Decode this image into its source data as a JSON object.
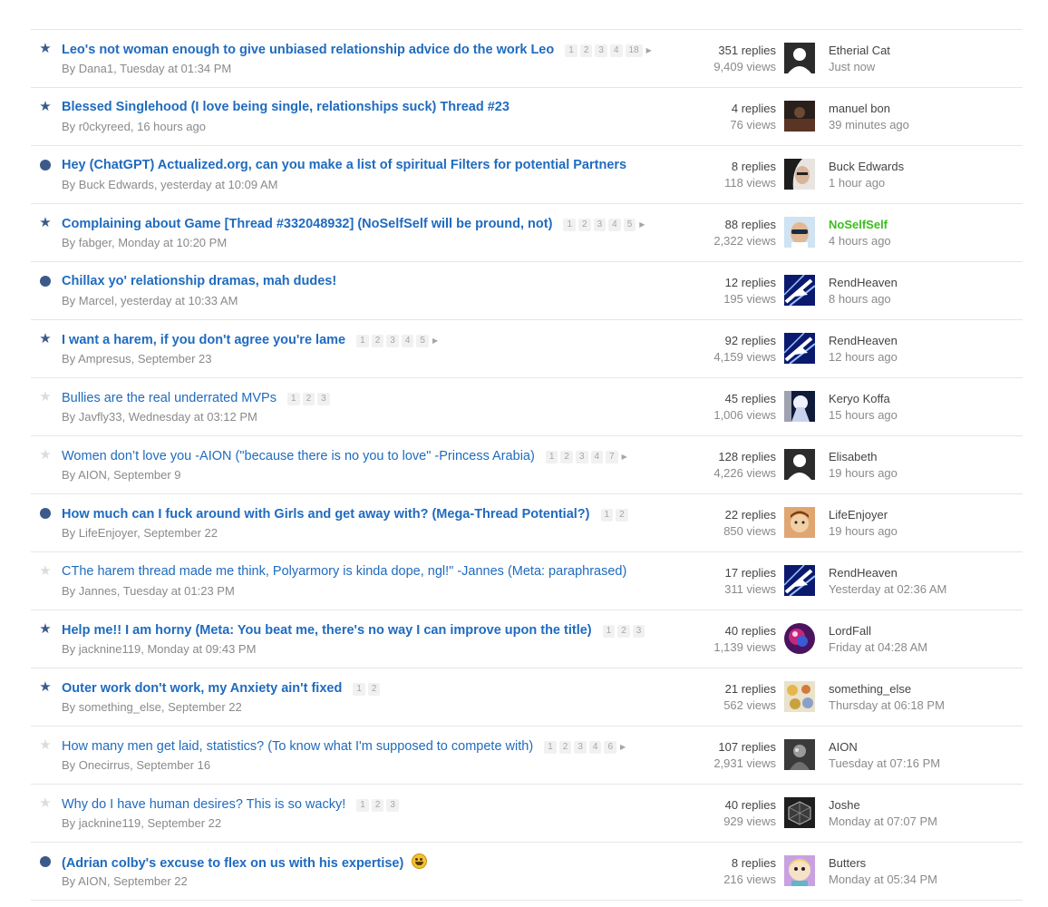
{
  "threads": [
    {
      "status": "star",
      "unread": true,
      "title": "Leo's not woman enough to give unbiased relationship advice do the work Leo",
      "pages": [
        "1",
        "2",
        "3",
        "4",
        "18"
      ],
      "more": true,
      "author": "Dana1",
      "date": "Tuesday at 01:34 PM",
      "replies": "351 replies",
      "views": "9,409 views",
      "last_user": "Etherial Cat",
      "last_time": "Just now",
      "avatar": "default"
    },
    {
      "status": "star",
      "unread": true,
      "title": "Blessed Singlehood (I love being single, relationships suck) Thread #23",
      "pages": [],
      "more": false,
      "author": "r0ckyreed",
      "date": "16 hours ago",
      "replies": "4 replies",
      "views": "76 views",
      "last_user": "manuel bon",
      "last_time": "39 minutes ago",
      "avatar": "dark"
    },
    {
      "status": "dot",
      "unread": true,
      "title": "Hey (ChatGPT) Actualized.org, can you make a list of spiritual Filters for potential Partners",
      "pages": [],
      "more": false,
      "author": "Buck Edwards",
      "date": "yesterday at 10:09 AM",
      "replies": "8 replies",
      "views": "118 views",
      "last_user": "Buck Edwards",
      "last_time": "1 hour ago",
      "avatar": "face"
    },
    {
      "status": "star",
      "unread": true,
      "title": "Complaining about Game [Thread #332048932] (NoSelfSelf will be pround, not)",
      "pages": [
        "1",
        "2",
        "3",
        "4",
        "5"
      ],
      "more": true,
      "author": "fabger",
      "date": "Monday at 10:20 PM",
      "replies": "88 replies",
      "views": "2,322 views",
      "last_user": "NoSelfSelf",
      "last_time": "4 hours ago",
      "avatar": "sunglasses",
      "highlight": true
    },
    {
      "status": "dot",
      "unread": true,
      "title": "Chillax yo' relationship dramas, mah dudes!",
      "pages": [],
      "more": false,
      "author": "Marcel",
      "date": "yesterday at 10:33 AM",
      "replies": "12 replies",
      "views": "195 views",
      "last_user": "RendHeaven",
      "last_time": "8 hours ago",
      "avatar": "jet"
    },
    {
      "status": "star",
      "unread": true,
      "title": "I want a harem, if you don't agree you're lame",
      "pages": [
        "1",
        "2",
        "3",
        "4",
        "5"
      ],
      "more": true,
      "author": "Ampresus",
      "date": "September 23",
      "replies": "92 replies",
      "views": "4,159 views",
      "last_user": "RendHeaven",
      "last_time": "12 hours ago",
      "avatar": "jet"
    },
    {
      "status": "star-off",
      "unread": false,
      "title": "Bullies are the real underrated MVPs",
      "pages": [
        "1",
        "2",
        "3"
      ],
      "more": false,
      "author": "Javfly33",
      "date": "Wednesday at 03:12 PM",
      "replies": "45 replies",
      "views": "1,006 views",
      "last_user": "Keryo Koffa",
      "last_time": "15 hours ago",
      "avatar": "anime"
    },
    {
      "status": "star-off",
      "unread": false,
      "title": "Women don’t love you -AION (\"because there is no you to love\" -Princess Arabia)",
      "pages": [
        "1",
        "2",
        "3",
        "4",
        "7"
      ],
      "more": true,
      "author": "AION",
      "date": "September 9",
      "replies": "128 replies",
      "views": "4,226 views",
      "last_user": "Elisabeth",
      "last_time": "19 hours ago",
      "avatar": "default"
    },
    {
      "status": "dot",
      "unread": true,
      "title": "How much can I fuck around with Girls and get away with? (Mega-Thread Potential?)",
      "pages": [
        "1",
        "2"
      ],
      "more": false,
      "author": "LifeEnjoyer",
      "date": "September 22",
      "replies": "22 replies",
      "views": "850 views",
      "last_user": "LifeEnjoyer",
      "last_time": "19 hours ago",
      "avatar": "cartoon"
    },
    {
      "status": "star-off",
      "unread": false,
      "title": "CThe harem thread made me think, Polyarmory is kinda dope, ngl!\" -Jannes (Meta: paraphrased)",
      "pages": [],
      "more": false,
      "author": "Jannes",
      "date": "Tuesday at 01:23 PM",
      "replies": "17 replies",
      "views": "311 views",
      "last_user": "RendHeaven",
      "last_time": "Yesterday at 02:36 AM",
      "avatar": "jet"
    },
    {
      "status": "star",
      "unread": true,
      "title": "Help me!! I am horny (Meta: You beat me, there's no way I can improve upon the title)",
      "pages": [
        "1",
        "2",
        "3"
      ],
      "more": false,
      "author": "jacknine119",
      "date": "Monday at 09:43 PM",
      "replies": "40 replies",
      "views": "1,139 views",
      "last_user": "LordFall",
      "last_time": "Friday at 04:28 AM",
      "avatar": "nebula"
    },
    {
      "status": "star",
      "unread": true,
      "title": "Outer work don't work, my Anxiety ain't fixed",
      "pages": [
        "1",
        "2"
      ],
      "more": false,
      "author": "something_else",
      "date": "September 22",
      "replies": "21 replies",
      "views": "562 views",
      "last_user": "something_else",
      "last_time": "Thursday at 06:18 PM",
      "avatar": "flowers"
    },
    {
      "status": "star-off",
      "unread": false,
      "title": "How many men get laid, statistics? (To know what I'm supposed to compete with)",
      "pages": [
        "1",
        "2",
        "3",
        "4",
        "6"
      ],
      "more": true,
      "author": "Onecirrus",
      "date": "September 16",
      "replies": "107 replies",
      "views": "2,931 views",
      "last_user": "AION",
      "last_time": "Tuesday at 07:16 PM",
      "avatar": "mono"
    },
    {
      "status": "star-off",
      "unread": false,
      "title": "Why do I have human desires? This is so wacky!",
      "pages": [
        "1",
        "2",
        "3"
      ],
      "more": false,
      "author": "jacknine119",
      "date": "September 22",
      "replies": "40 replies",
      "views": "929 views",
      "last_user": "Joshe",
      "last_time": "Monday at 07:07 PM",
      "avatar": "cube"
    },
    {
      "status": "dot",
      "unread": true,
      "title": "(Adrian colby's excuse to flex on us with his expertise)",
      "pages": [],
      "more": false,
      "emoji": true,
      "author": "AION",
      "date": "September 22",
      "replies": "8 replies",
      "views": "216 views",
      "last_user": "Butters",
      "last_time": "Monday at 05:34 PM",
      "avatar": "butters"
    }
  ]
}
